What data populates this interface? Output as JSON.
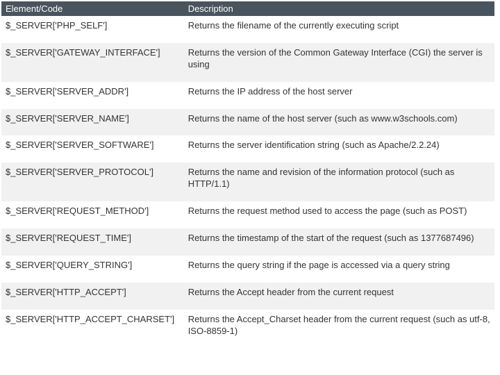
{
  "headers": {
    "code": "Element/Code",
    "desc": "Description"
  },
  "rows": [
    {
      "code": "$_SERVER['PHP_SELF']",
      "desc": "Returns the filename of the currently executing script"
    },
    {
      "code": "$_SERVER['GATEWAY_INTERFACE']",
      "desc": "Returns the version of the Common Gateway Interface (CGI) the server is using"
    },
    {
      "code": "$_SERVER['SERVER_ADDR']",
      "desc": "Returns the IP address of the host server"
    },
    {
      "code": "$_SERVER['SERVER_NAME']",
      "desc": "Returns the name of the host server (such as www.w3schools.com)"
    },
    {
      "code": "$_SERVER['SERVER_SOFTWARE']",
      "desc": "Returns the server identification string (such as Apache/2.2.24)"
    },
    {
      "code": "$_SERVER['SERVER_PROTOCOL']",
      "desc": "Returns the name and revision of the information protocol (such as HTTP/1.1)"
    },
    {
      "code": "$_SERVER['REQUEST_METHOD']",
      "desc": "Returns the request method used to access the page (such as POST)"
    },
    {
      "code": "$_SERVER['REQUEST_TIME']",
      "desc": "Returns the timestamp of the start of the request (such as 1377687496)"
    },
    {
      "code": "$_SERVER['QUERY_STRING']",
      "desc": "Returns the query string if the page is accessed via a query string"
    },
    {
      "code": "$_SERVER['HTTP_ACCEPT']",
      "desc": "Returns the Accept header from the current request"
    },
    {
      "code": "$_SERVER['HTTP_ACCEPT_CHARSET']",
      "desc": "Returns the Accept_Charset header from the current request (such as utf-8, ISO-8859-1)"
    }
  ]
}
